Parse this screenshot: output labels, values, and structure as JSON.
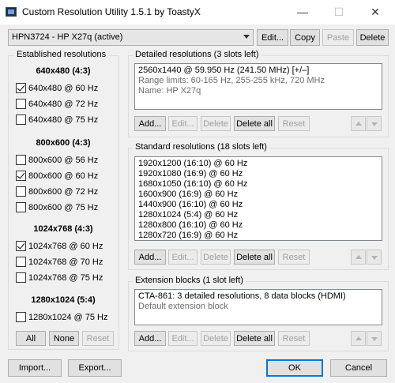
{
  "window": {
    "title": "Custom Resolution Utility 1.5.1 by ToastyX",
    "minimize": "—",
    "maximize": "☐",
    "close": "✕"
  },
  "monitor": {
    "selected": "HPN3724 - HP X27q (active)",
    "buttons": [
      "Edit...",
      "Copy",
      "Paste",
      "Delete"
    ]
  },
  "established": {
    "title": "Established resolutions",
    "sections": [
      {
        "heading": "640x480 (4:3)",
        "items": [
          {
            "label": "640x480 @ 60 Hz",
            "checked": true
          },
          {
            "label": "640x480 @ 72 Hz",
            "checked": false
          },
          {
            "label": "640x480 @ 75 Hz",
            "checked": false
          }
        ]
      },
      {
        "heading": "800x600 (4:3)",
        "items": [
          {
            "label": "800x600 @ 56 Hz",
            "checked": false
          },
          {
            "label": "800x600 @ 60 Hz",
            "checked": true
          },
          {
            "label": "800x600 @ 72 Hz",
            "checked": false
          },
          {
            "label": "800x600 @ 75 Hz",
            "checked": false
          }
        ]
      },
      {
        "heading": "1024x768 (4:3)",
        "items": [
          {
            "label": "1024x768 @ 60 Hz",
            "checked": true
          },
          {
            "label": "1024x768 @ 70 Hz",
            "checked": false
          },
          {
            "label": "1024x768 @ 75 Hz",
            "checked": false
          }
        ]
      },
      {
        "heading": "1280x1024 (5:4)",
        "items": [
          {
            "label": "1280x1024 @ 75 Hz",
            "checked": false
          }
        ]
      }
    ],
    "buttons": {
      "all": "All",
      "none": "None",
      "reset": "Reset"
    }
  },
  "detailed": {
    "title": "Detailed resolutions (3 slots left)",
    "items": [
      {
        "text": "2560x1440 @ 59.950 Hz (241.50 MHz) [+/–]",
        "gray": false
      },
      {
        "text": "Range limits: 60-165 Hz, 255-255 kHz, 720 MHz",
        "gray": true
      },
      {
        "text": "Name: HP X27q",
        "gray": true
      }
    ]
  },
  "standard": {
    "title": "Standard resolutions (18 slots left)",
    "items": [
      {
        "text": "1920x1200 (16:10) @ 60 Hz",
        "gray": false
      },
      {
        "text": "1920x1080 (16:9) @ 60 Hz",
        "gray": false
      },
      {
        "text": "1680x1050 (16:10) @ 60 Hz",
        "gray": false
      },
      {
        "text": "1600x900 (16:9) @ 60 Hz",
        "gray": false
      },
      {
        "text": "1440x900 (16:10) @ 60 Hz",
        "gray": false
      },
      {
        "text": "1280x1024 (5:4) @ 60 Hz",
        "gray": false
      },
      {
        "text": "1280x800 (16:10) @ 60 Hz",
        "gray": false
      },
      {
        "text": "1280x720 (16:9) @ 60 Hz",
        "gray": false
      }
    ]
  },
  "extension": {
    "title": "Extension blocks (1 slot left)",
    "items": [
      {
        "text": "CTA-861: 3 detailed resolutions, 8 data blocks (HDMI)",
        "gray": false
      },
      {
        "text": "Default extension block",
        "gray": true
      }
    ]
  },
  "list_buttons": {
    "add": "Add...",
    "edit": "Edit...",
    "delete": "Delete",
    "delete_all": "Delete all",
    "reset": "Reset"
  },
  "footer": {
    "import": "Import...",
    "export": "Export...",
    "ok": "OK",
    "cancel": "Cancel"
  }
}
